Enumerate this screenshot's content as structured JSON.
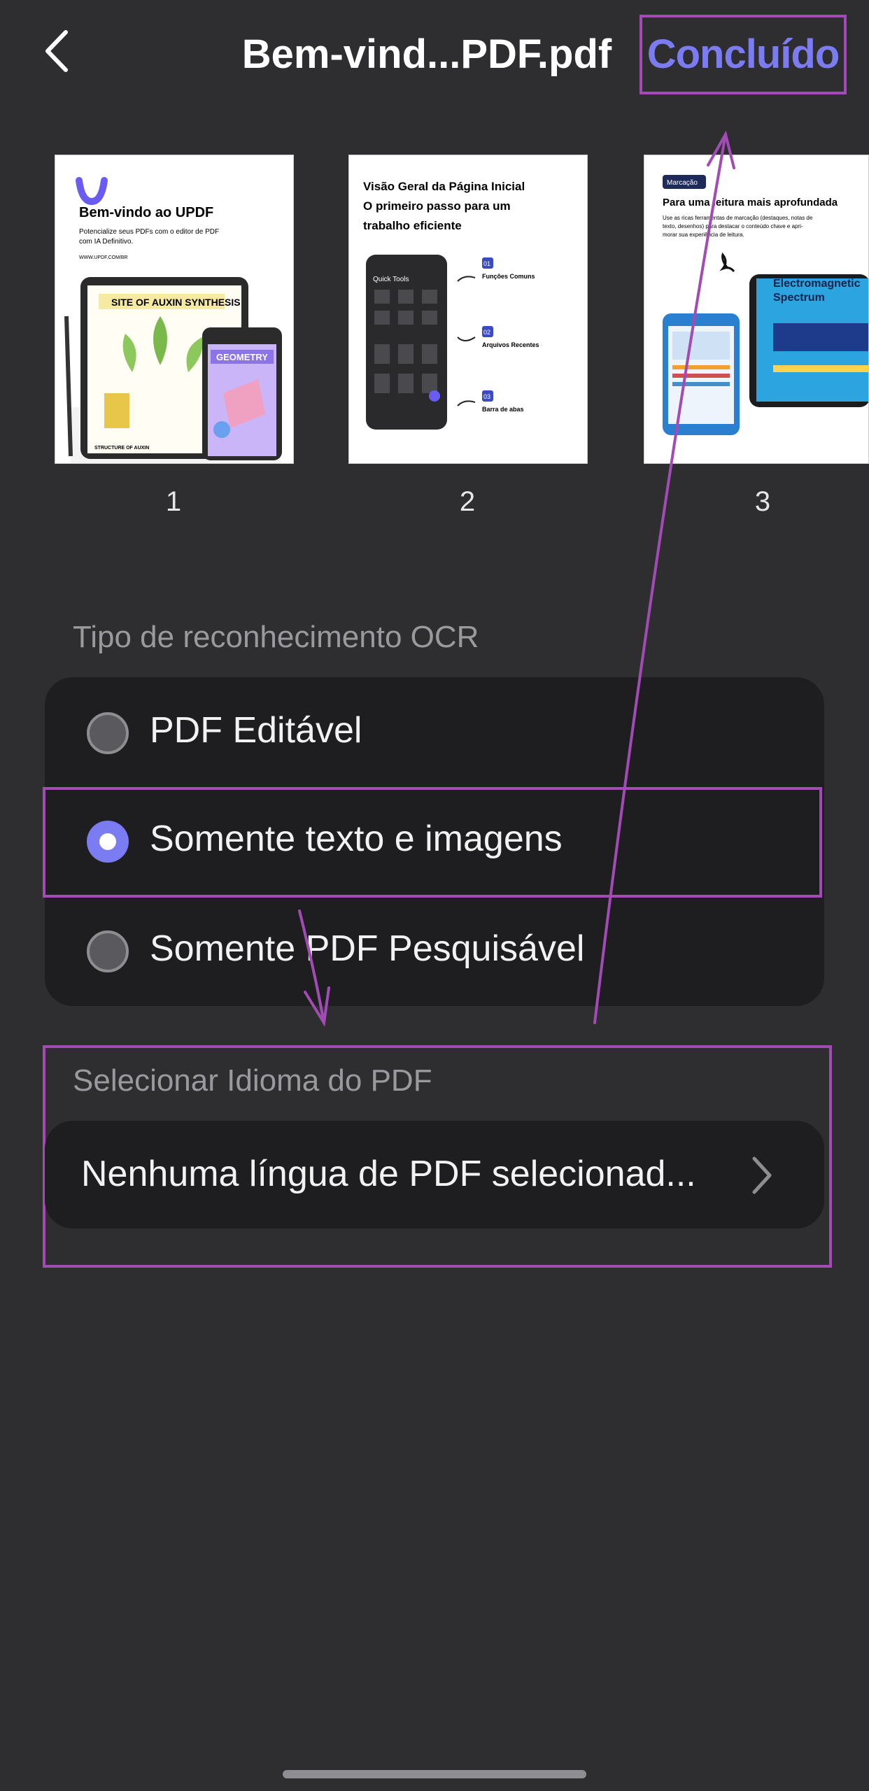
{
  "header": {
    "title": "Bem-vind...PDF.pdf",
    "done_label": "Concluído"
  },
  "pages": [
    {
      "number": "1",
      "title": "Bem-vindo ao UPDF",
      "subtitle": "Potencialize seus PDFs com o editor de PDF com IA Definitivo.",
      "url": "WWW.UPDF.COM/BR",
      "art_labels": [
        "SITE OF AUXIN SYNTHESIS",
        "GEOMETRY",
        "STRUCTURE OF AUXIN"
      ]
    },
    {
      "number": "2",
      "title": "Visão Geral da Página Inicial O primeiro passo para um trabalho eficiente",
      "phone_label": "Quick Tools",
      "items": [
        {
          "num": "01",
          "label": "Funções Comuns"
        },
        {
          "num": "02",
          "label": "Arquivos Recentes"
        },
        {
          "num": "03",
          "label": "Barra de abas"
        }
      ]
    },
    {
      "number": "3",
      "tag": "Marcação",
      "title": "Para uma leitura mais aprofundada",
      "subtitle": "Use as ricas ferramentas de marcação (destaques, notas de texto, desenhos) para destacar o conteúdo chave e aprimorar sua experiência de leitura.",
      "art_label": "Electromagnetic Spectrum"
    }
  ],
  "ocr": {
    "section_label": "Tipo de reconhecimento OCR",
    "options": [
      {
        "label": "PDF Editável",
        "selected": false
      },
      {
        "label": "Somente texto e imagens",
        "selected": true
      },
      {
        "label": "Somente PDF Pesquisável",
        "selected": false
      }
    ]
  },
  "language": {
    "section_label": "Selecionar Idioma do PDF",
    "value": "Nenhuma língua de PDF selecionad..."
  },
  "colors": {
    "background": "#2e2e30",
    "card": "#1e1e20",
    "accent": "#7b7bf2",
    "annotation": "#a24bb5"
  },
  "icons": [
    "back-chevron-icon",
    "forward-chevron-icon",
    "radio-icon"
  ]
}
